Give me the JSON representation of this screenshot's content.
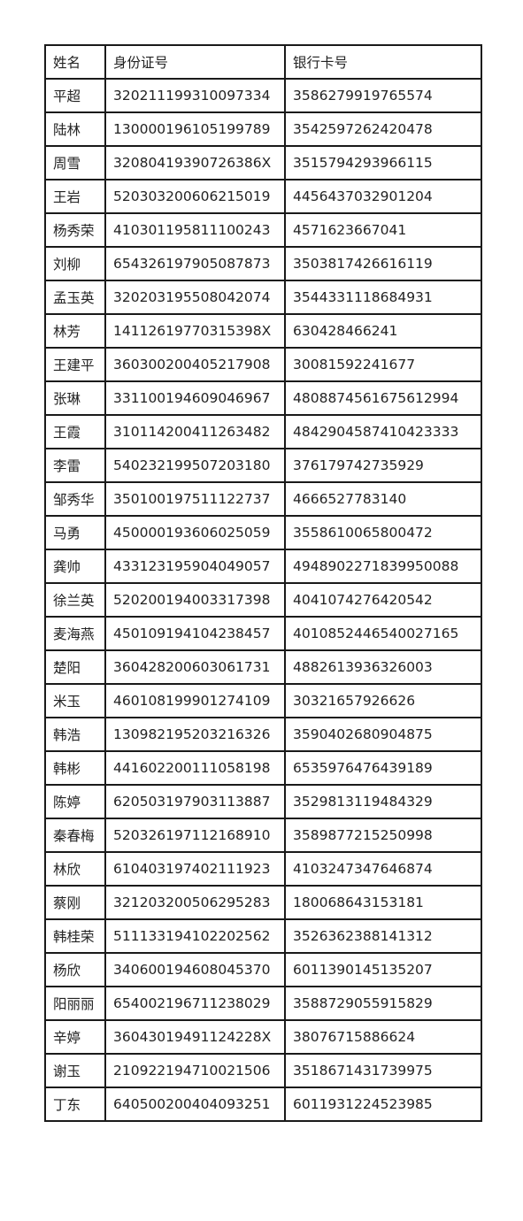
{
  "table": {
    "headers": [
      "姓名",
      "身份证号",
      "银行卡号"
    ],
    "rows": [
      [
        "平超",
        "320211199310097334",
        "3586279919765574"
      ],
      [
        "陆林",
        "130000196105199789",
        "3542597262420478"
      ],
      [
        "周雪",
        "32080419390726386X",
        "3515794293966115"
      ],
      [
        "王岩",
        "520303200606215019",
        "4456437032901204"
      ],
      [
        "杨秀荣",
        "410301195811100243",
        "4571623667041"
      ],
      [
        "刘柳",
        "654326197905087873",
        "3503817426616119"
      ],
      [
        "孟玉英",
        "320203195508042074",
        "3544331118684931"
      ],
      [
        "林芳",
        "14112619770315398X",
        "630428466241"
      ],
      [
        "王建平",
        "360300200405217908",
        "30081592241677"
      ],
      [
        "张琳",
        "331100194609046967",
        "4808874561675612994"
      ],
      [
        "王霞",
        "310114200411263482",
        "4842904587410423333"
      ],
      [
        "李雷",
        "540232199507203180",
        "376179742735929"
      ],
      [
        "邹秀华",
        "350100197511122737",
        "4666527783140"
      ],
      [
        "马勇",
        "450000193606025059",
        "3558610065800472"
      ],
      [
        "龚帅",
        "433123195904049057",
        "4948902271839950088"
      ],
      [
        "徐兰英",
        "520200194003317398",
        "4041074276420542"
      ],
      [
        "麦海燕",
        "450109194104238457",
        "4010852446540027165"
      ],
      [
        "楚阳",
        "360428200603061731",
        "4882613936326003"
      ],
      [
        "米玉",
        "460108199901274109",
        "30321657926626"
      ],
      [
        "韩浩",
        "130982195203216326",
        "3590402680904875"
      ],
      [
        "韩彬",
        "441602200111058198",
        "6535976476439189"
      ],
      [
        "陈婷",
        "620503197903113887",
        "3529813119484329"
      ],
      [
        "秦春梅",
        "520326197112168910",
        "3589877215250998"
      ],
      [
        "林欣",
        "610403197402111923",
        "4103247347646874"
      ],
      [
        "蔡刚",
        "321203200506295283",
        "180068643153181"
      ],
      [
        "韩桂荣",
        "511133194102202562",
        "3526362388141312"
      ],
      [
        "杨欣",
        "340600194608045370",
        "6011390145135207"
      ],
      [
        "阳丽丽",
        "654002196711238029",
        "3588729055915829"
      ],
      [
        "辛婷",
        "36043019491124228X",
        "38076715886624"
      ],
      [
        "谢玉",
        "210922194710021506",
        "3518671431739975"
      ],
      [
        "丁东",
        "640500200404093251",
        "6011931224523985"
      ]
    ]
  }
}
